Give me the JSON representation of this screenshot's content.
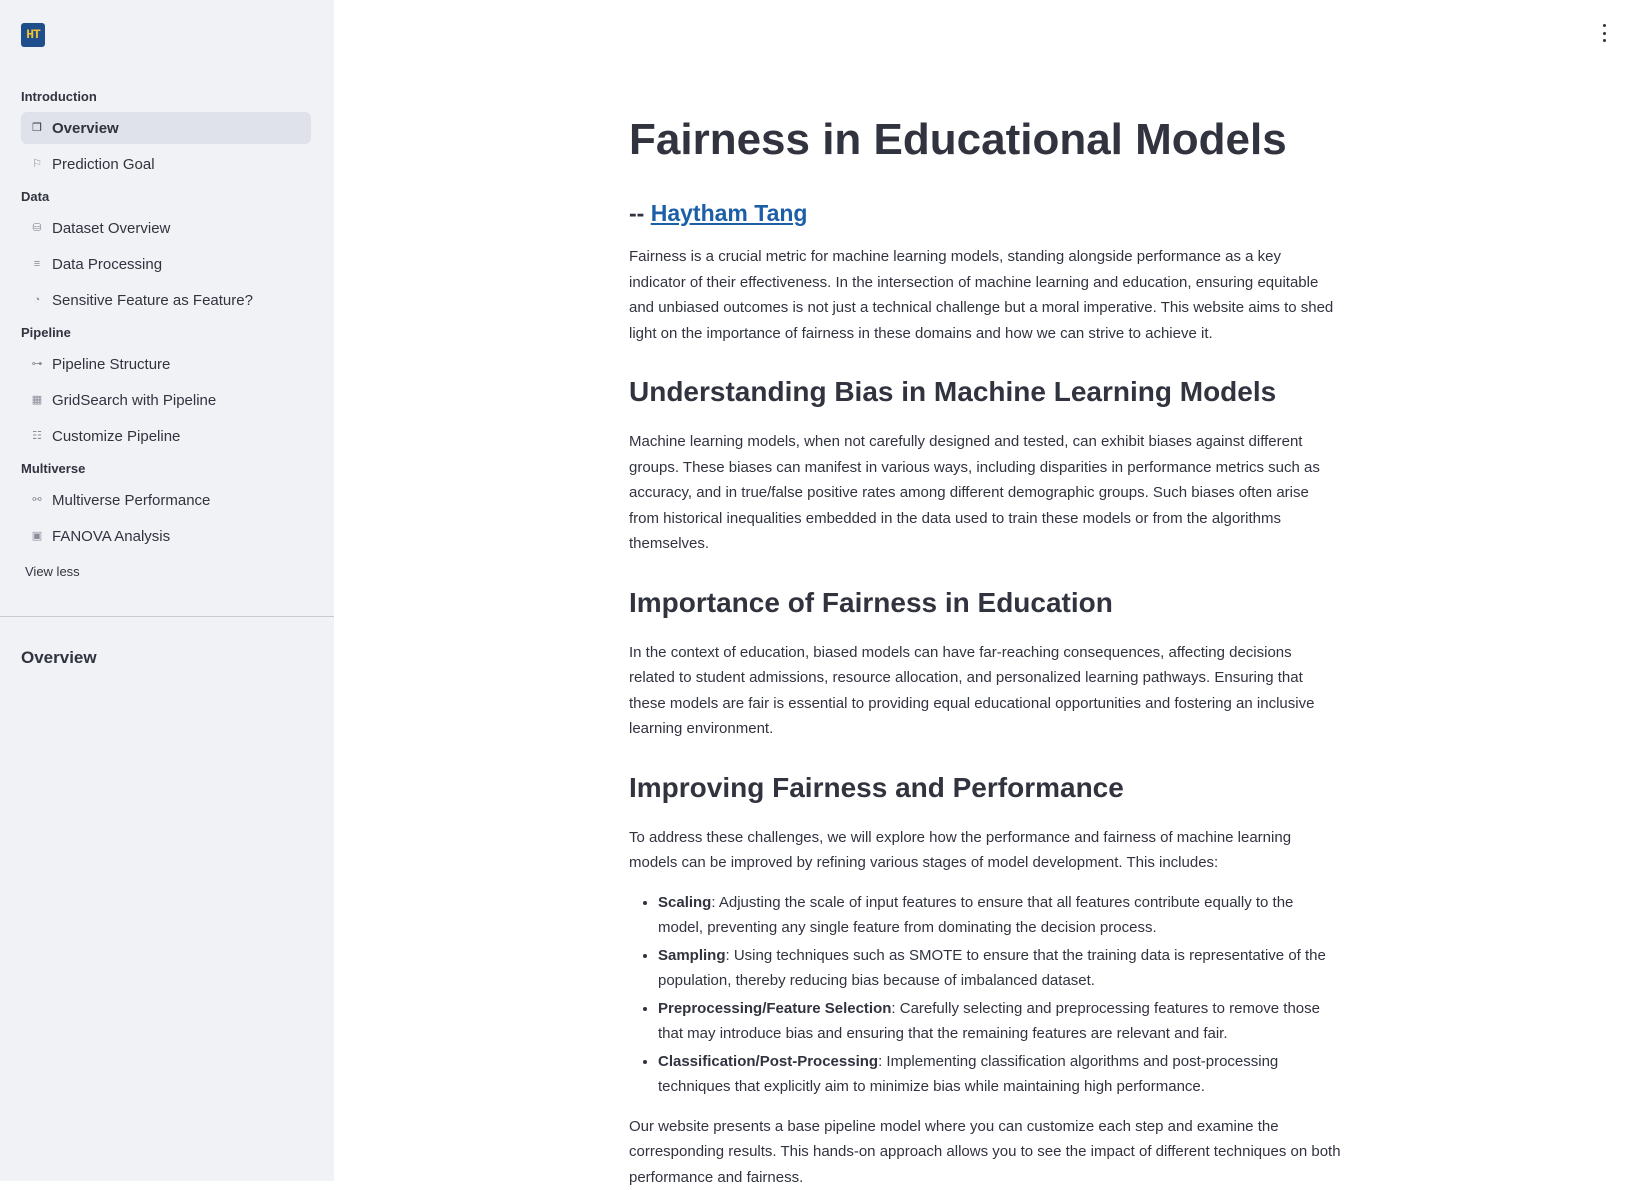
{
  "sidebar": {
    "logo_text": "HT",
    "sections": [
      {
        "title": "Introduction",
        "items": [
          {
            "label": "Overview",
            "icon": "page-icon",
            "glyph": "❐",
            "active": true
          },
          {
            "label": "Prediction Goal",
            "icon": "flag-icon",
            "glyph": "⚐"
          }
        ]
      },
      {
        "title": "Data",
        "items": [
          {
            "label": "Dataset Overview",
            "icon": "database-icon",
            "glyph": "⛁"
          },
          {
            "label": "Data Processing",
            "icon": "lines-icon",
            "glyph": "≡"
          },
          {
            "label": "Sensitive Feature as Feature?",
            "icon": "head-icon",
            "glyph": "◔"
          }
        ]
      },
      {
        "title": "Pipeline",
        "items": [
          {
            "label": "Pipeline Structure",
            "icon": "tree-icon",
            "glyph": "⊶"
          },
          {
            "label": "GridSearch with Pipeline",
            "icon": "grid-icon",
            "glyph": "▦"
          },
          {
            "label": "Customize Pipeline",
            "icon": "sliders-icon",
            "glyph": "☷"
          }
        ]
      },
      {
        "title": "Multiverse",
        "items": [
          {
            "label": "Multiverse Performance",
            "icon": "graph-icon",
            "glyph": "⚯"
          },
          {
            "label": "FANOVA Analysis",
            "icon": "chart-icon",
            "glyph": "▣"
          }
        ]
      }
    ],
    "view_less": "View less",
    "sub_title": "Overview"
  },
  "main": {
    "title": "Fairness in Educational Models",
    "author_prefix": "-- ",
    "author_name": "Haytham Tang",
    "intro": "Fairness is a crucial metric for machine learning models, standing alongside performance as a key indicator of their effectiveness. In the intersection of machine learning and education, ensuring equitable and unbiased outcomes is not just a technical challenge but a moral imperative. This website aims to shed light on the importance of fairness in these domains and how we can strive to achieve it.",
    "h_bias": "Understanding Bias in Machine Learning Models",
    "p_bias": "Machine learning models, when not carefully designed and tested, can exhibit biases against different groups. These biases can manifest in various ways, including disparities in performance metrics such as accuracy, and in true/false positive rates among different demographic groups. Such biases often arise from historical inequalities embedded in the data used to train these models or from the algorithms themselves.",
    "h_importance": "Importance of Fairness in Education",
    "p_importance": "In the context of education, biased models can have far-reaching consequences, affecting decisions related to student admissions, resource allocation, and personalized learning pathways. Ensuring that these models are fair is essential to providing equal educational opportunities and fostering an inclusive learning environment.",
    "h_improving": "Improving Fairness and Performance",
    "p_improving": "To address these challenges, we will explore how the performance and fairness of machine learning models can be improved by refining various stages of model development. This includes:",
    "bullets": [
      {
        "term": "Scaling",
        "text": ": Adjusting the scale of input features to ensure that all features contribute equally to the model, preventing any single feature from dominating the decision process."
      },
      {
        "term": "Sampling",
        "text": ": Using techniques such as SMOTE to ensure that the training data is representative of the population, thereby reducing bias because of imbalanced dataset."
      },
      {
        "term": "Preprocessing/Feature Selection",
        "text": ": Carefully selecting and preprocessing features to remove those that may introduce bias and ensuring that the remaining features are relevant and fair."
      },
      {
        "term": "Classification/Post-Processing",
        "text": ": Implementing classification algorithms and post-processing techniques that explicitly aim to minimize bias while maintaining high performance."
      }
    ],
    "p_closing": "Our website presents a base pipeline model where you can customize each step and examine the corresponding results. This hands-on approach allows you to see the impact of different techniques on both performance and fairness."
  }
}
